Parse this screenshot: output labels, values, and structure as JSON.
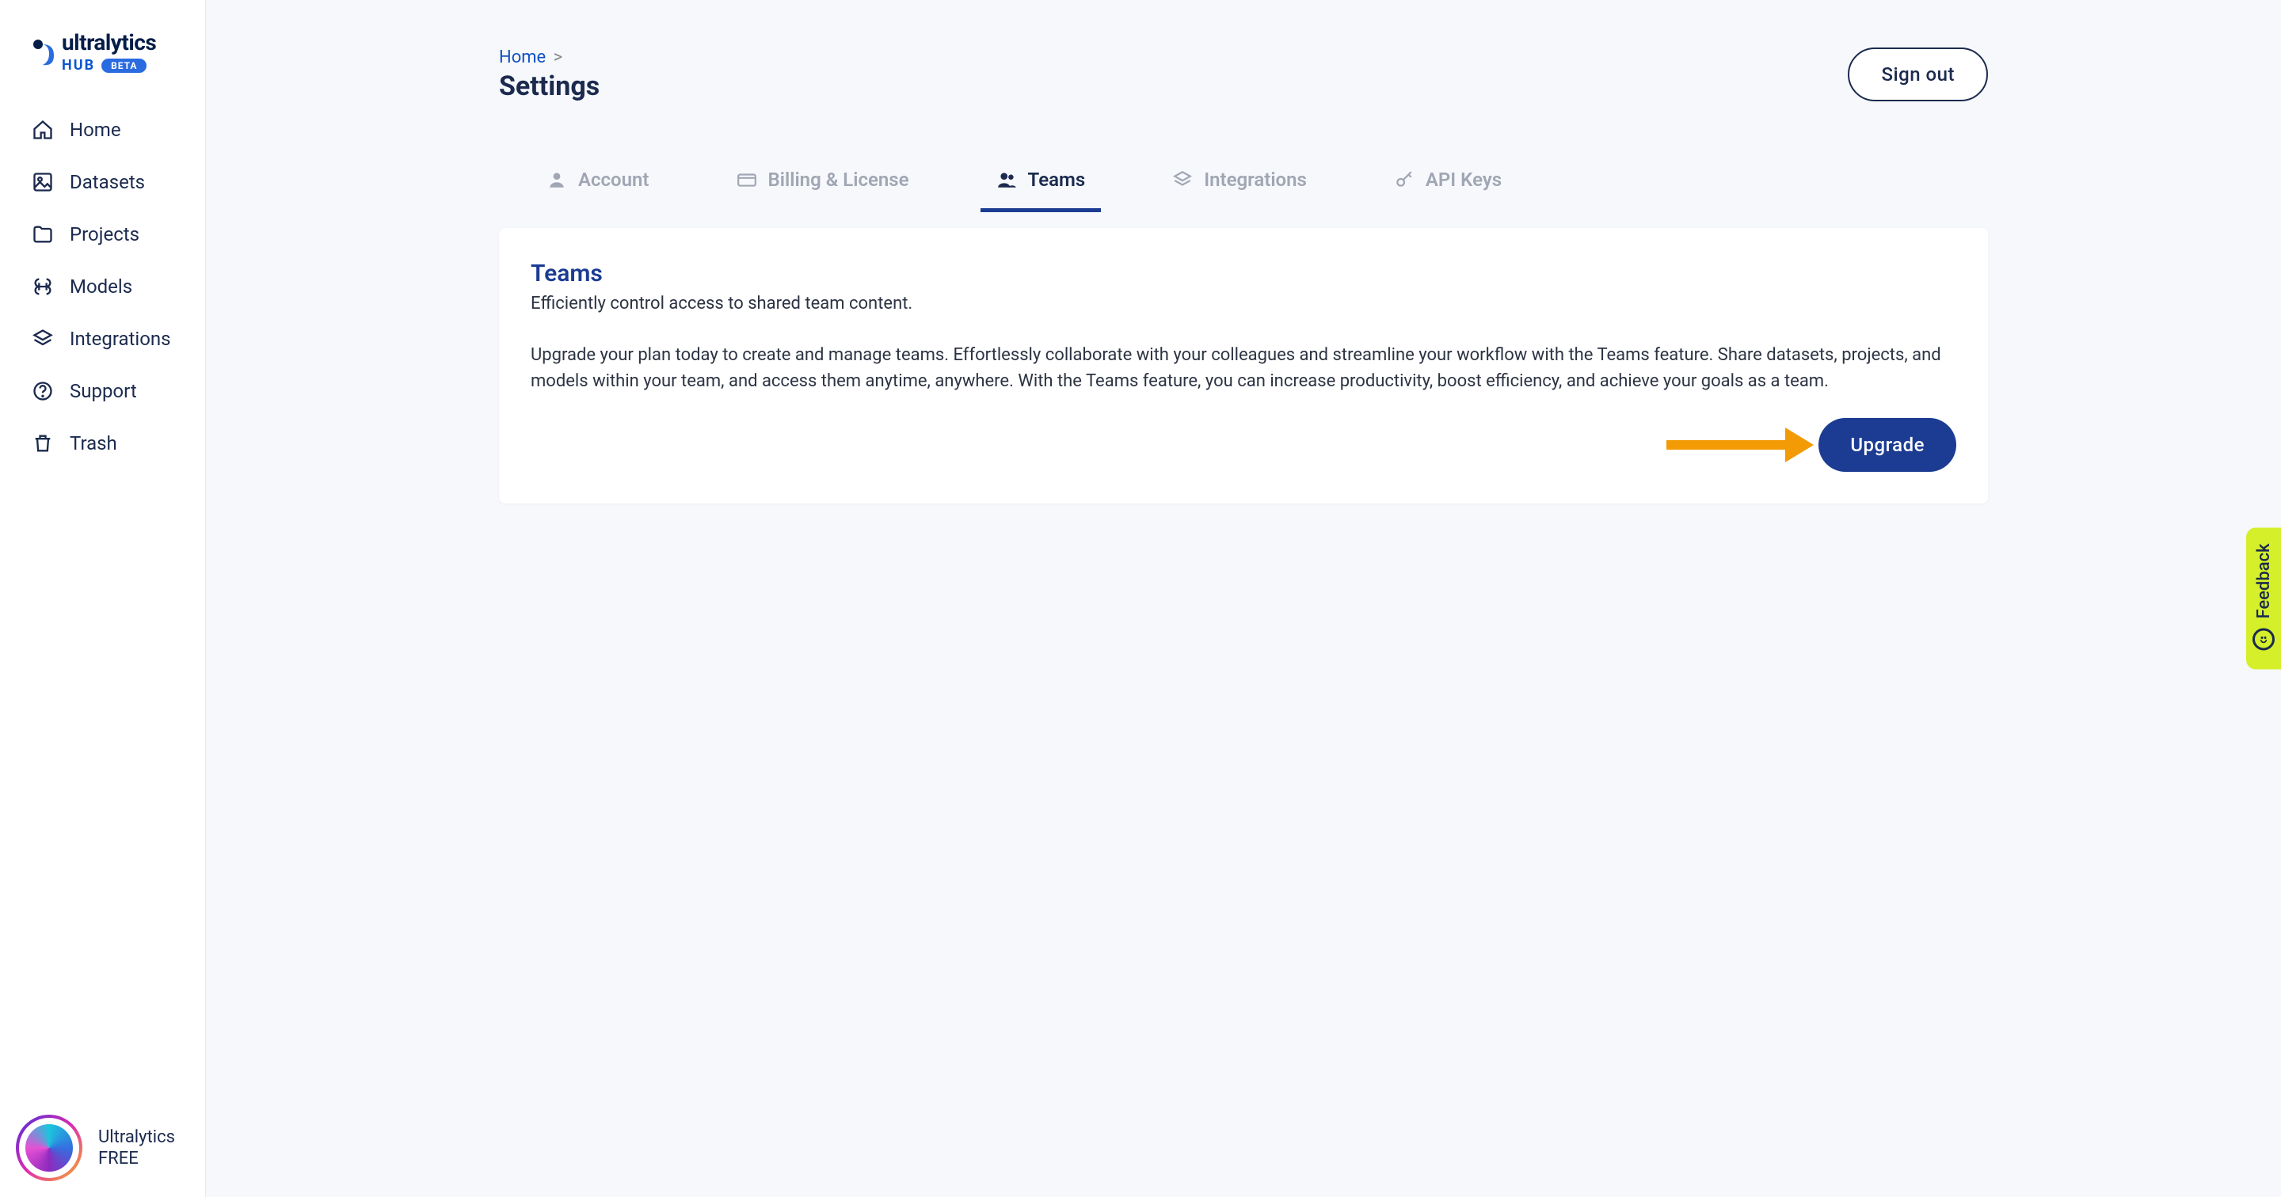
{
  "brand": {
    "name": "ultralytics",
    "hub": "HUB",
    "beta": "BETA"
  },
  "sidebar": {
    "items": [
      {
        "label": "Home"
      },
      {
        "label": "Datasets"
      },
      {
        "label": "Projects"
      },
      {
        "label": "Models"
      },
      {
        "label": "Integrations"
      },
      {
        "label": "Support"
      },
      {
        "label": "Trash"
      }
    ],
    "account": {
      "name": "Ultralytics",
      "plan": "FREE"
    }
  },
  "header": {
    "breadcrumb_home": "Home",
    "breadcrumb_sep": ">",
    "title": "Settings",
    "signout": "Sign out"
  },
  "tabs": [
    {
      "label": "Account"
    },
    {
      "label": "Billing & License"
    },
    {
      "label": "Teams"
    },
    {
      "label": "Integrations"
    },
    {
      "label": "API Keys"
    }
  ],
  "card": {
    "title": "Teams",
    "subtitle": "Efficiently control access to shared team content.",
    "body": "Upgrade your plan today to create and manage teams. Effortlessly collaborate with your colleagues and streamline your workflow with the Teams feature. Share datasets, projects, and models within your team, and access them anytime, anywhere. With the Teams feature, you can increase productivity, boost efficiency, and achieve your goals as a team.",
    "upgrade_label": "Upgrade"
  },
  "feedback": {
    "label": "Feedback"
  }
}
